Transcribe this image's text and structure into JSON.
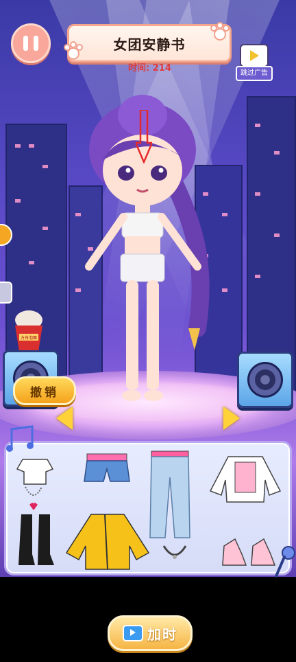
{
  "header": {
    "title": "女团安静书",
    "timer_text": "时间: 214",
    "skip_ad_label": "跳过广告"
  },
  "scene": {
    "noodle_label": "方舟泡面"
  },
  "controls": {
    "undo_label": "撤销",
    "add_time_label": "加时"
  },
  "wardrobe": {
    "items": [
      "white-crop-top-icon",
      "denim-shorts-icon",
      "light-wash-jeans-icon",
      "white-jacket-pink-top-icon",
      "heart-necklace-icon",
      "black-boots-icon",
      "yellow-varsity-jacket-icon",
      "silver-choker-icon",
      "pink-sneakers-icon"
    ]
  },
  "colors": {
    "accent": "#f5a21c",
    "timer": "#e03a3a",
    "panel": "#e7ecff"
  }
}
